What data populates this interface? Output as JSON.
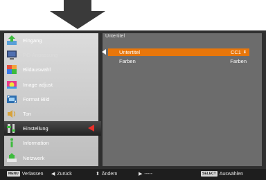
{
  "menu": {
    "items": [
      {
        "label": "Eingang",
        "icon": "input-icon",
        "state": "normal"
      },
      {
        "label": "PC-Anpassung",
        "icon": "pc-adjust-icon",
        "state": "disabled"
      },
      {
        "label": "Bildauswahl",
        "icon": "image-select-icon",
        "state": "normal"
      },
      {
        "label": "Image adjust",
        "icon": "image-adjust-icon",
        "state": "normal"
      },
      {
        "label": "Format Bild",
        "icon": "screen-format-icon",
        "state": "normal"
      },
      {
        "label": "Ton",
        "icon": "sound-icon",
        "state": "normal"
      },
      {
        "label": "Einstellung",
        "icon": "settings-icon",
        "state": "selected"
      },
      {
        "label": "Information",
        "icon": "information-icon",
        "state": "normal"
      },
      {
        "label": "Netzwerk",
        "icon": "network-icon",
        "state": "normal"
      }
    ]
  },
  "submenu": {
    "title": "Untertitel",
    "rows": [
      {
        "label": "Untertitel",
        "value": "CC1",
        "selected": true
      },
      {
        "label": "Farben",
        "value": "Farben",
        "selected": false
      }
    ]
  },
  "statusbar": {
    "menu_key": "MENU",
    "exit_label": "Verlassen",
    "back_label": "Zurück",
    "change_label": "Ändern",
    "next_label": "-----",
    "select_key": "SELECT",
    "select_label": "Auswählen"
  },
  "colors": {
    "accent_orange": "#e8760a",
    "selection_arrow_red": "#e8302a"
  }
}
